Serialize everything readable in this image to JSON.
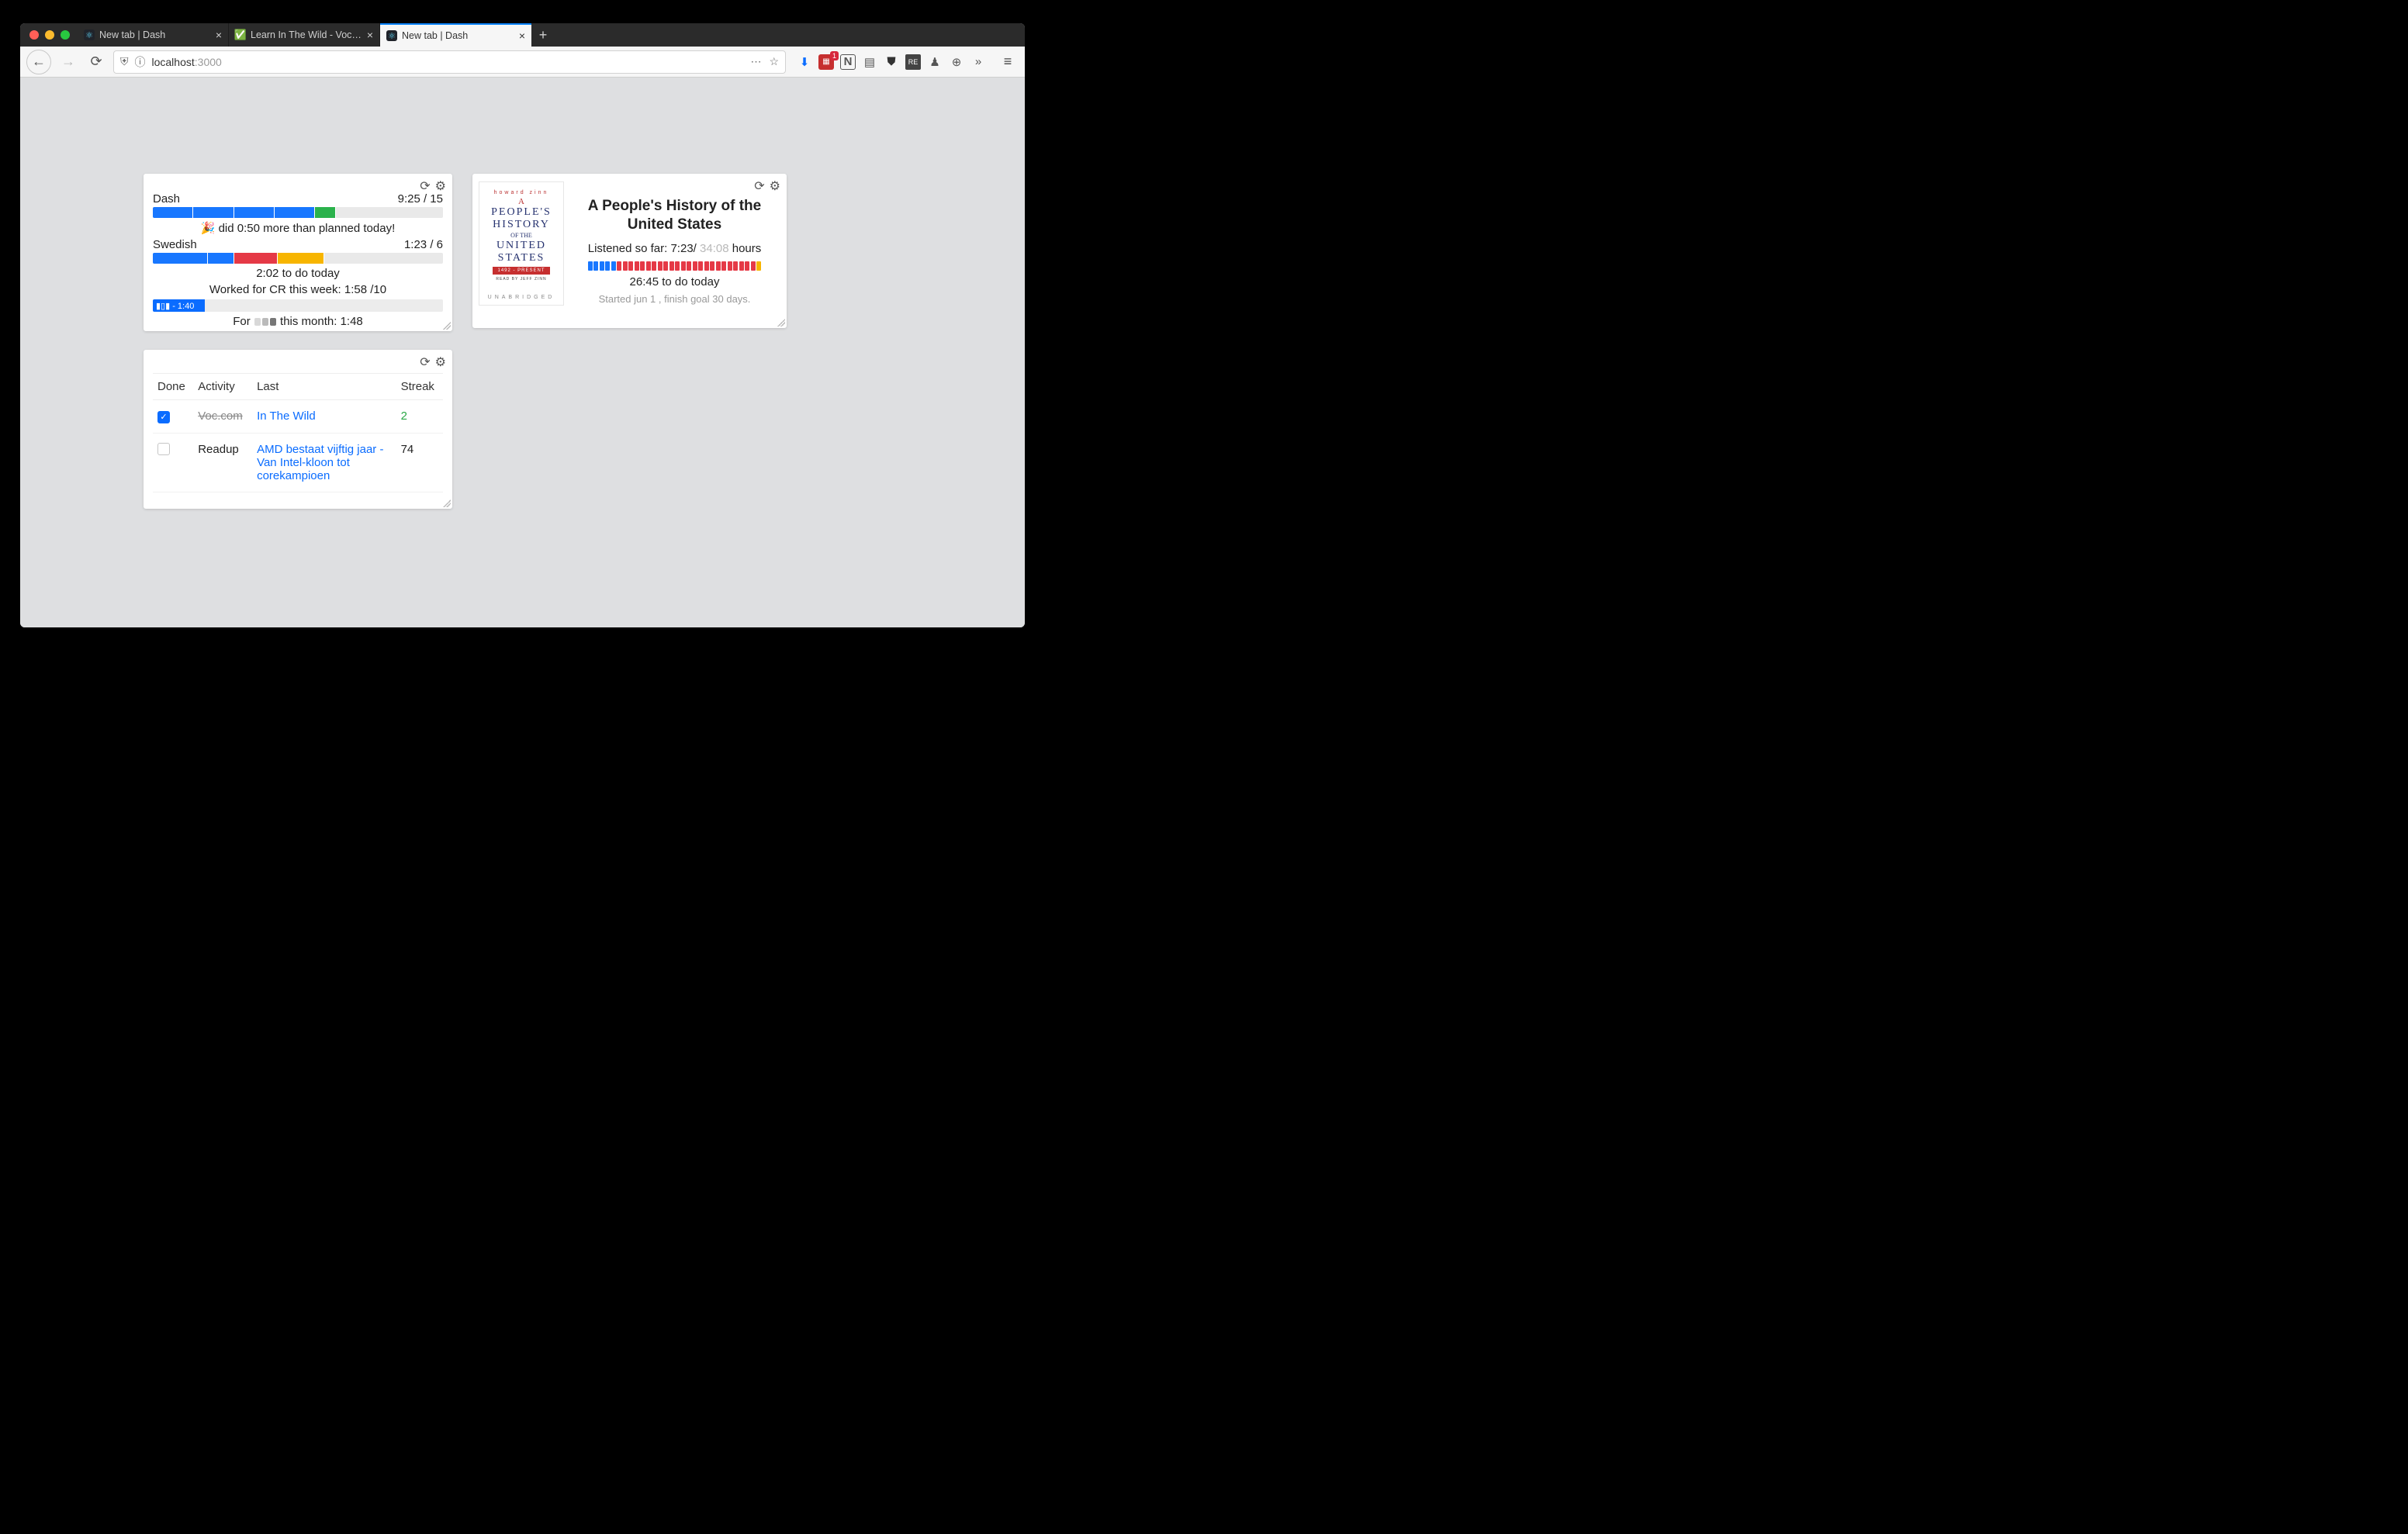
{
  "browser": {
    "tabs": [
      {
        "title": "New tab | Dash",
        "active": false,
        "favicon": "react"
      },
      {
        "title": "Learn In The Wild - Vocabulary",
        "active": false,
        "favicon": "check"
      },
      {
        "title": "New tab | Dash",
        "active": true,
        "favicon": "react"
      }
    ],
    "url_display_main": "localhost",
    "url_display_port": ":3000",
    "overflow_glyph": "»",
    "ext_badge": "1"
  },
  "tracker": {
    "items": [
      {
        "label": "Dash",
        "right": "9:25 / 15",
        "bar": [
          {
            "w": 14,
            "c": "#1877ff"
          },
          {
            "w": 14,
            "c": "#1877ff"
          },
          {
            "w": 14,
            "c": "#1877ff"
          },
          {
            "w": 14,
            "c": "#1877ff"
          },
          {
            "w": 7,
            "c": "#2bb24c"
          }
        ],
        "caption_prefix": "🎉 did ",
        "caption_main": "0:50 more than planned today!"
      },
      {
        "label": "Swedish",
        "right": "1:23 / 6",
        "bar": [
          {
            "w": 19,
            "c": "#1877ff"
          },
          {
            "w": 9,
            "c": "#1877ff"
          },
          {
            "w": 15,
            "c": "#e53946"
          },
          {
            "w": 16,
            "c": "#f7b500"
          }
        ],
        "caption_main": "2:02 to do today"
      }
    ],
    "week_line": "Worked for CR this week: 1:58 /10",
    "mini_fill_label": "▮▯▮ - 1:40",
    "mini_fill_pct": 18,
    "month_line_prefix": "For ",
    "month_line_suffix": " this month: 1:48"
  },
  "book": {
    "cover": {
      "author": "howard zinn",
      "line_a": "A",
      "title1": "PEOPLE'S",
      "title2": "HISTORY",
      "of": "OF THE",
      "title3": "UNITED",
      "title4": "STATES",
      "stripe": "1492 - PRESENT",
      "readby": "READ BY JEFF ZINN",
      "unab": "UNABRIDGED"
    },
    "title": "A People's History of the United States",
    "listened_prefix": "Listened so far: ",
    "listened_done": "7:23",
    "listened_sep": "/ ",
    "listened_total": "34:08",
    "listened_suffix": " hours",
    "segments": [
      "#1877ff",
      "#1877ff",
      "#1877ff",
      "#1877ff",
      "#1877ff",
      "#e53946",
      "#e53946",
      "#e53946",
      "#e53946",
      "#e53946",
      "#e53946",
      "#e53946",
      "#e53946",
      "#e53946",
      "#e53946",
      "#e53946",
      "#e53946",
      "#e53946",
      "#e53946",
      "#e53946",
      "#e53946",
      "#e53946",
      "#e53946",
      "#e53946",
      "#e53946",
      "#e53946",
      "#e53946",
      "#e53946",
      "#e53946",
      "#f7b500"
    ],
    "todo": "26:45 to do today",
    "meta": "Started jun 1 , finish goal 30 days."
  },
  "habits": {
    "headers": {
      "done": "Done",
      "activity": "Activity",
      "last": "Last",
      "streak": "Streak"
    },
    "rows": [
      {
        "checked": true,
        "activity": "Voc.com",
        "last": "In The Wild",
        "streak": "2",
        "streak_good": true
      },
      {
        "checked": false,
        "activity": "Readup",
        "last": "AMD bestaat vijftig jaar - Van Intel-kloon tot corekampioen",
        "streak": "74",
        "streak_good": false
      }
    ]
  }
}
